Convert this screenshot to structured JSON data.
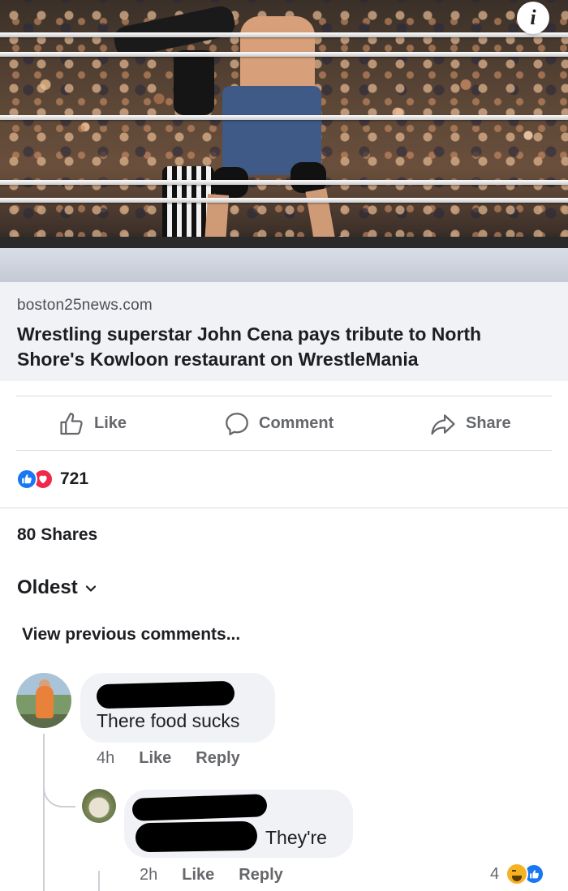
{
  "post": {
    "image_alt": "John Cena at WrestleMania",
    "link_domain": "boston25news.com",
    "link_title": "Wrestling superstar John Cena pays tribute to North Shore's Kowloon restaurant on WrestleMania"
  },
  "actions": {
    "like_label": "Like",
    "comment_label": "Comment",
    "share_label": "Share"
  },
  "reactions": {
    "count": "721",
    "icons": [
      "like-icon",
      "love-icon"
    ]
  },
  "shares": "80 Shares",
  "sort": {
    "label": "Oldest",
    "icon": "chevron-down-icon"
  },
  "view_previous": "View previous comments...",
  "comments": [
    {
      "text": "There food sucks",
      "time": "4h",
      "like_label": "Like",
      "reply_label": "Reply"
    },
    {
      "text": "They're",
      "time": "2h",
      "like_label": "Like",
      "reply_label": "Reply",
      "reaction_count": "4",
      "reaction_icons": [
        "haha-icon",
        "like-icon"
      ]
    }
  ],
  "colors": {
    "facebook_blue": "#1877f2",
    "love_red": "#f02849",
    "secondary_text": "#65676b",
    "bubble_bg": "#f0f2f5"
  }
}
